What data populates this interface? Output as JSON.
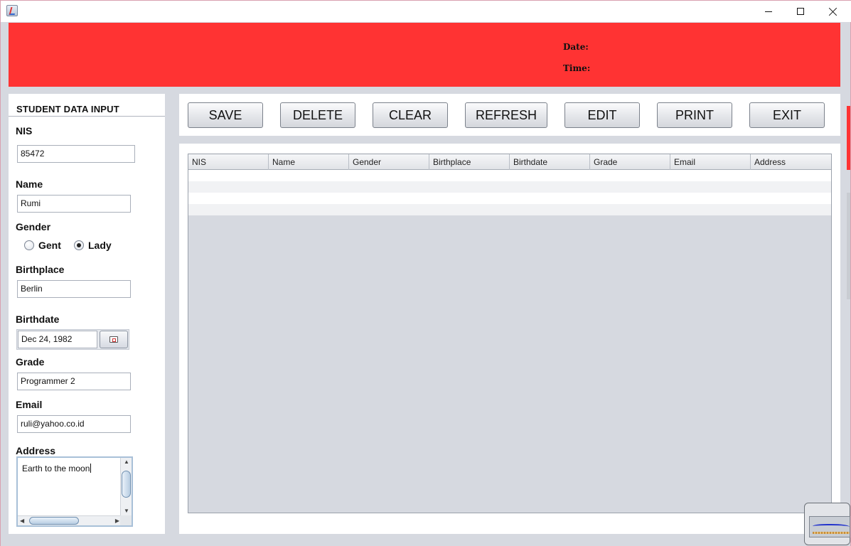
{
  "window": {
    "app_icon": "java-cup-icon",
    "controls": [
      "minimize",
      "maximize",
      "close"
    ]
  },
  "header": {
    "date_label": "Date:",
    "time_label": "Time:",
    "color": "#ff3333"
  },
  "form": {
    "title": "STUDENT DATA INPUT",
    "nis_label": "NIS",
    "nis_value": "85472",
    "name_label": "Name",
    "name_value": "Rumi",
    "gender_label": "Gender",
    "gender_options": [
      "Gent",
      "Lady"
    ],
    "gender_selected": "Lady",
    "birthplace_label": "Birthplace",
    "birthplace_value": "Berlin",
    "birthdate_label": "Birthdate",
    "birthdate_value": "Dec 24, 1982",
    "grade_label": "Grade",
    "grade_value": "Programmer 2",
    "email_label": "Email",
    "email_value": "ruli@yahoo.co.id",
    "address_label": "Address",
    "address_value": "Earth to the moon"
  },
  "toolbar": {
    "save": "SAVE",
    "delete": "DELETE",
    "clear": "CLEAR",
    "refresh": "REFRESH",
    "edit": "EDIT",
    "print": "PRINT",
    "exit": "EXIT"
  },
  "table": {
    "columns": [
      "NIS",
      "Name",
      "Gender",
      "Birthplace",
      "Birthdate",
      "Grade",
      "Email",
      "Address"
    ],
    "rows": []
  }
}
